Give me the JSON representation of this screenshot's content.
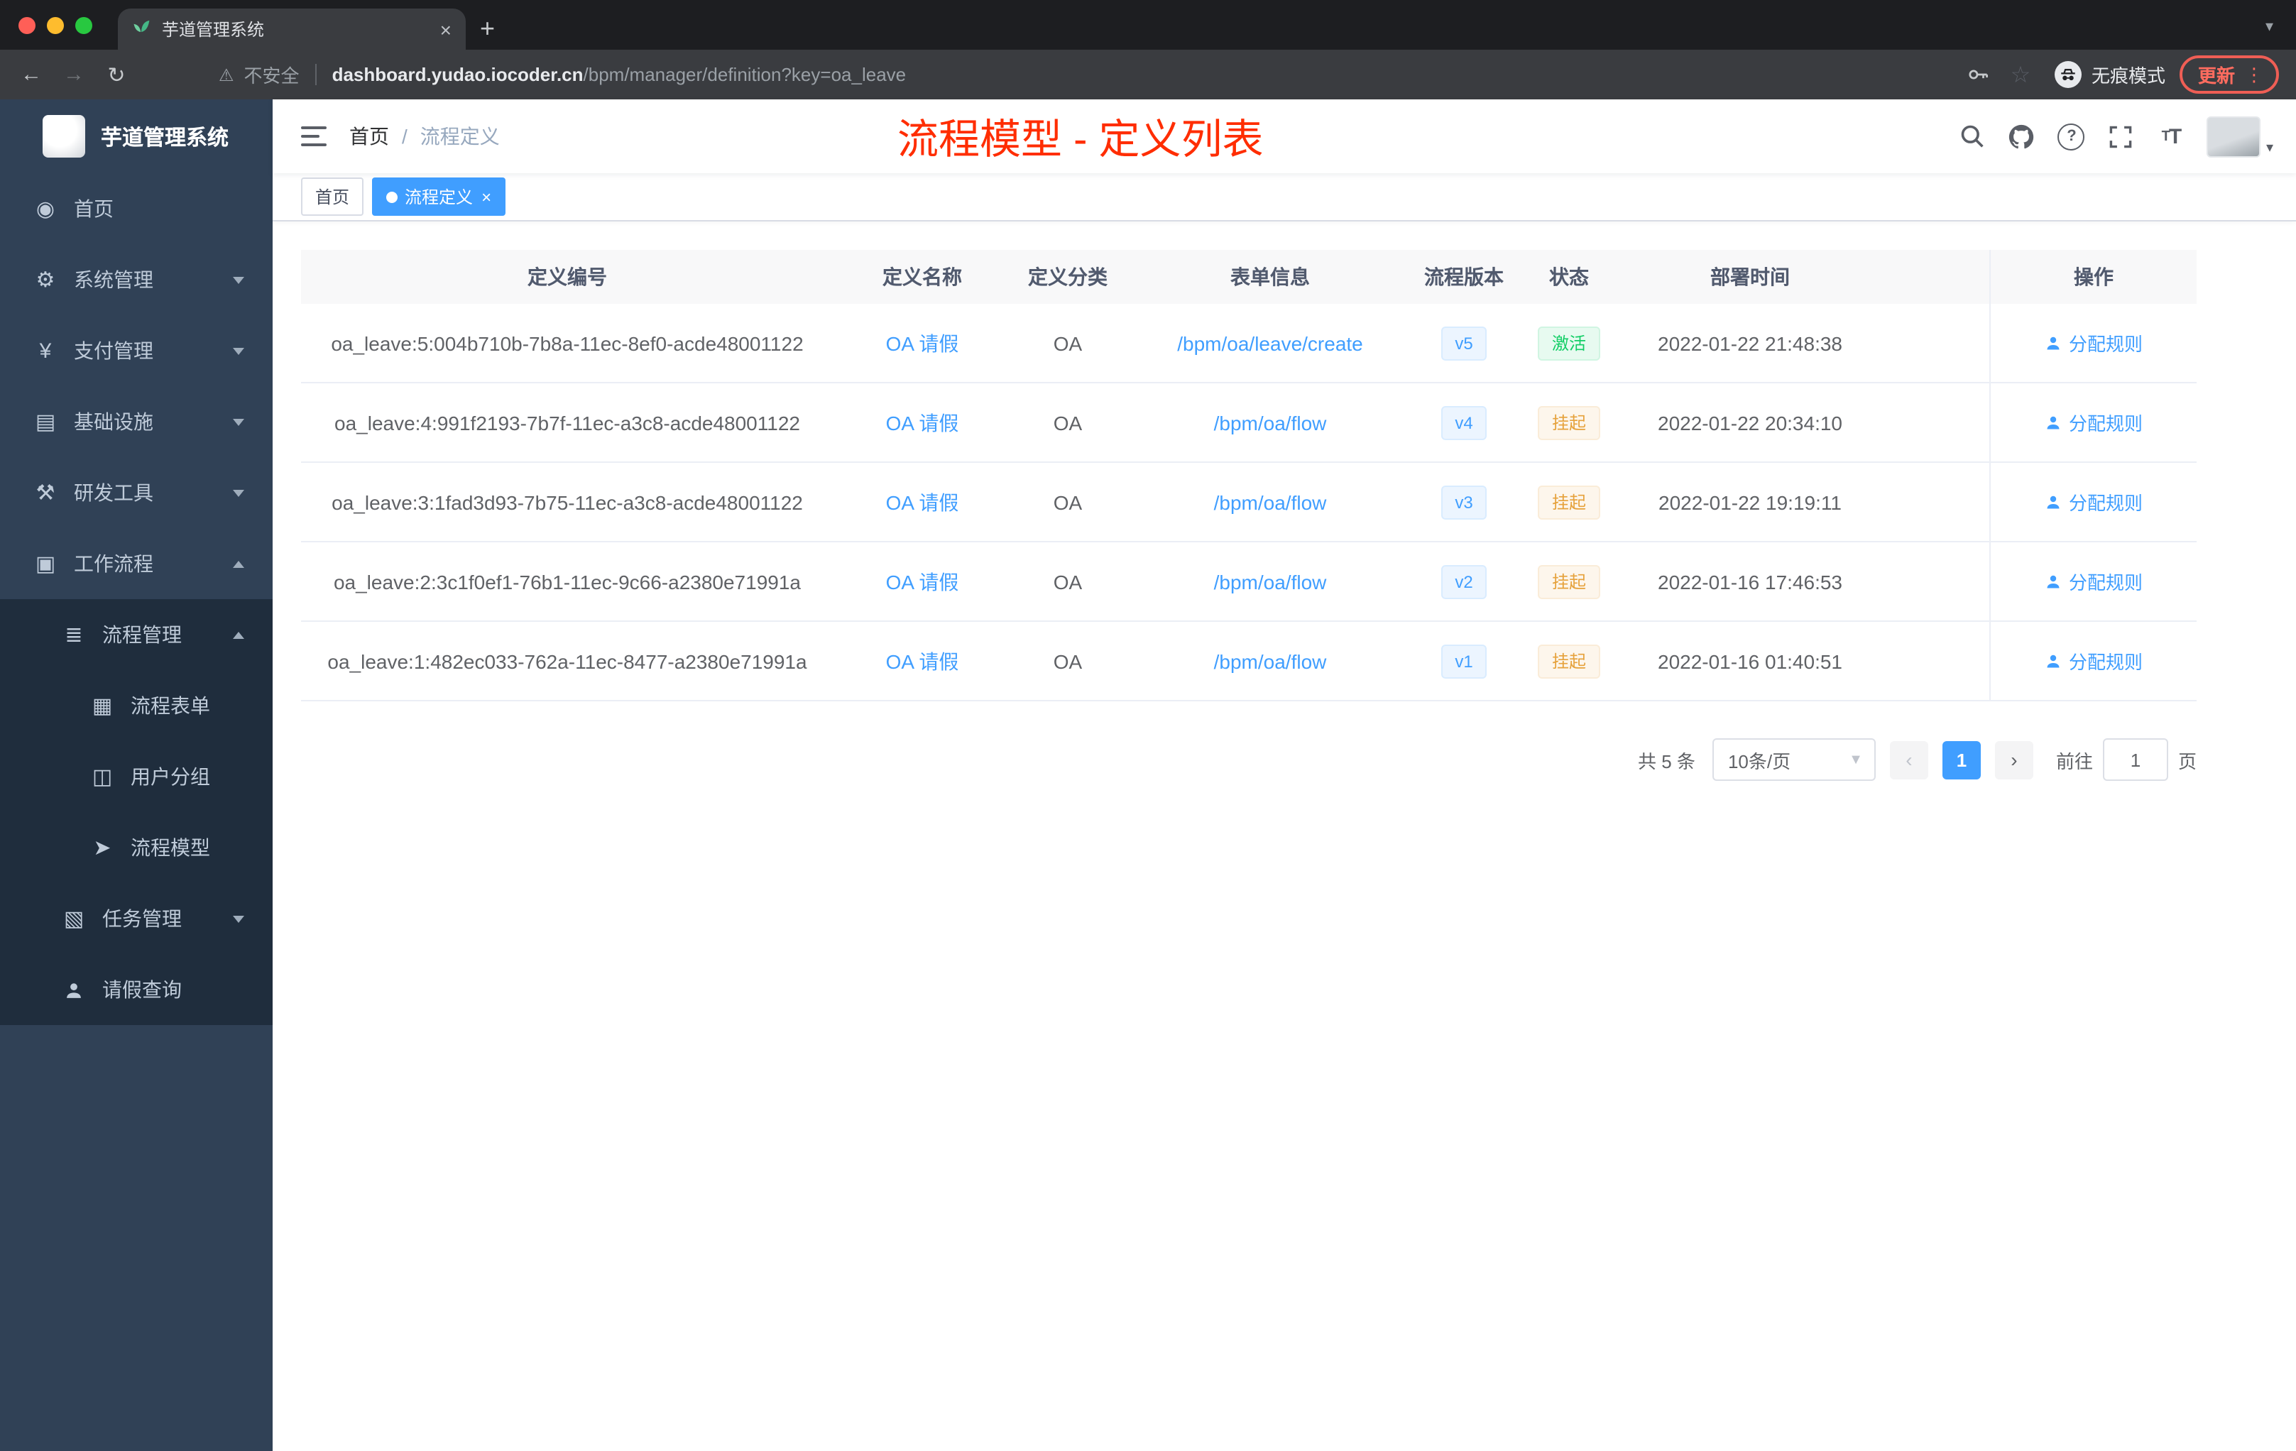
{
  "colors": {
    "accent_blue": "#409eff",
    "success_green": "#13ce66",
    "warning_orange": "#e6a23c",
    "annotation_red": "#ff2d00",
    "sidebar_bg": "#304156"
  },
  "browser": {
    "tab_title": "芋道管理系统",
    "security_label": "不安全",
    "url_domain": "dashboard.yudao.iocoder.cn",
    "url_path": "/bpm/manager/definition?key=oa_leave",
    "incognito_label": "无痕模式",
    "update_label": "更新"
  },
  "sidebar": {
    "logo_title": "芋道管理系统",
    "icons": {
      "dashboard": "◉",
      "gear": "⚙",
      "yen": "¥",
      "infra": "▤",
      "tools": "⚒",
      "workflow": "▣",
      "process": "≣",
      "form": "▦",
      "group": "◫",
      "model": "➤",
      "task": "▧"
    },
    "items": [
      {
        "label": "首页"
      },
      {
        "label": "系统管理"
      },
      {
        "label": "支付管理"
      },
      {
        "label": "基础设施"
      },
      {
        "label": "研发工具"
      },
      {
        "label": "工作流程"
      },
      {
        "label": "流程管理"
      },
      {
        "label": "流程表单"
      },
      {
        "label": "用户分组"
      },
      {
        "label": "流程模型"
      },
      {
        "label": "任务管理"
      },
      {
        "label": "请假查询"
      }
    ]
  },
  "header": {
    "breadcrumb_home": "首页",
    "breadcrumb_sep": "/",
    "breadcrumb_current": "流程定义",
    "annotation": "流程模型 - 定义列表"
  },
  "tags": {
    "home": "首页",
    "current": "流程定义"
  },
  "table": {
    "headers": [
      "定义编号",
      "定义名称",
      "定义分类",
      "表单信息",
      "流程版本",
      "状态",
      "部署时间",
      "操作"
    ],
    "rows": [
      {
        "id": "oa_leave:5:004b710b-7b8a-11ec-8ef0-acde48001122",
        "name": "OA 请假",
        "category": "OA",
        "form": "/bpm/oa/leave/create",
        "version": "v5",
        "status": "激活",
        "status_type": "success",
        "deploy_time": "2022-01-22 21:48:38",
        "action": "分配规则"
      },
      {
        "id": "oa_leave:4:991f2193-7b7f-11ec-a3c8-acde48001122",
        "name": "OA 请假",
        "category": "OA",
        "form": "/bpm/oa/flow",
        "version": "v4",
        "status": "挂起",
        "status_type": "warning",
        "deploy_time": "2022-01-22 20:34:10",
        "action": "分配规则"
      },
      {
        "id": "oa_leave:3:1fad3d93-7b75-11ec-a3c8-acde48001122",
        "name": "OA 请假",
        "category": "OA",
        "form": "/bpm/oa/flow",
        "version": "v3",
        "status": "挂起",
        "status_type": "warning",
        "deploy_time": "2022-01-22 19:19:11",
        "action": "分配规则"
      },
      {
        "id": "oa_leave:2:3c1f0ef1-76b1-11ec-9c66-a2380e71991a",
        "name": "OA 请假",
        "category": "OA",
        "form": "/bpm/oa/flow",
        "version": "v2",
        "status": "挂起",
        "status_type": "warning",
        "deploy_time": "2022-01-16 17:46:53",
        "action": "分配规则"
      },
      {
        "id": "oa_leave:1:482ec033-762a-11ec-8477-a2380e71991a",
        "name": "OA 请假",
        "category": "OA",
        "form": "/bpm/oa/flow",
        "version": "v1",
        "status": "挂起",
        "status_type": "warning",
        "deploy_time": "2022-01-16 01:40:51",
        "action": "分配规则"
      }
    ]
  },
  "pagination": {
    "total": "共 5 条",
    "page_size": "10条/页",
    "current_page": "1",
    "goto": "前往",
    "goto_value": "1",
    "page_unit": "页"
  }
}
